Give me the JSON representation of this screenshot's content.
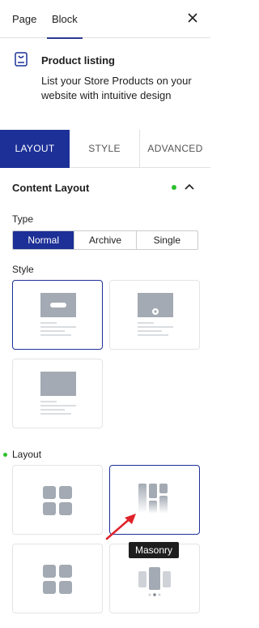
{
  "top_tabs": {
    "page": "Page",
    "block": "Block"
  },
  "block": {
    "title": "Product listing",
    "description": "List your Store Products on your website with intuitive design"
  },
  "panel_tabs": {
    "layout": "LAYOUT",
    "style": "STYLE",
    "advanced": "ADVANCED"
  },
  "content_layout": {
    "heading": "Content Layout"
  },
  "type": {
    "label": "Type",
    "options": [
      "Normal",
      "Archive",
      "Single"
    ],
    "selected": "Normal"
  },
  "style_section": {
    "label": "Style",
    "selected_index": 0
  },
  "layout_section": {
    "label": "Layout",
    "selected_index": 1
  },
  "tooltip": "Masonry",
  "colors": {
    "accent": "#1d3097",
    "modified_dot": "#2bc02b",
    "arrow": "#e0222a"
  }
}
